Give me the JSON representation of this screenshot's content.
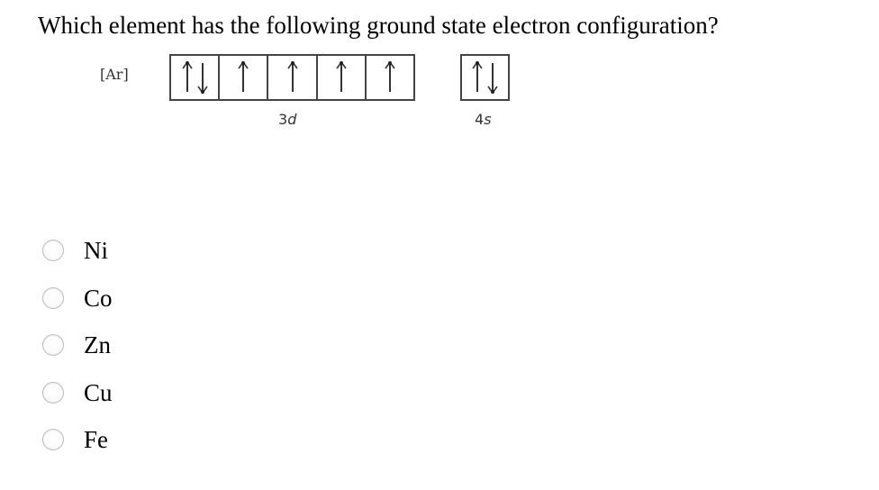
{
  "question": {
    "text": "Which element has the following ground state electron configuration?"
  },
  "configuration": {
    "core": "[Ar]",
    "subshells": [
      {
        "id": "3d",
        "label_number": "3",
        "label_letter": "d",
        "orbitals": [
          [
            "up",
            "down"
          ],
          [
            "up"
          ],
          [
            "up"
          ],
          [
            "up"
          ],
          [
            "up"
          ]
        ]
      },
      {
        "id": "4s",
        "label_number": "4",
        "label_letter": "s",
        "orbitals": [
          [
            "up",
            "down"
          ]
        ]
      }
    ]
  },
  "options": [
    {
      "label": "Ni",
      "selected": false
    },
    {
      "label": "Co",
      "selected": false
    },
    {
      "label": "Zn",
      "selected": false
    },
    {
      "label": "Cu",
      "selected": false
    },
    {
      "label": "Fe",
      "selected": false
    }
  ]
}
